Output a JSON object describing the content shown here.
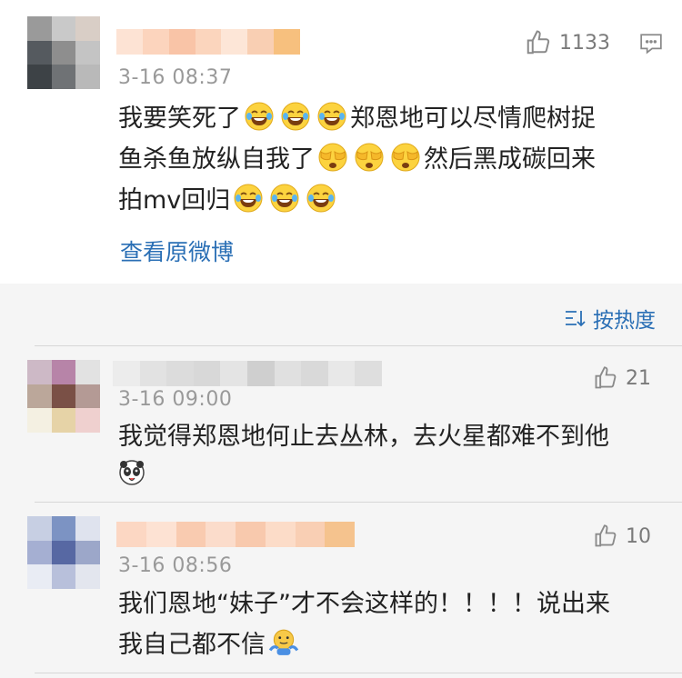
{
  "main_comment": {
    "time": "3-16 08:37",
    "like_count": "1133",
    "text_lines": [
      {
        "before": "我要笑死了",
        "emojis": [
          "laugh",
          "laugh",
          "laugh"
        ],
        "after": "郑恩地可以尽情爬树捉"
      },
      {
        "before": "鱼杀鱼放纵自我了",
        "emojis": [
          "facepalm",
          "facepalm",
          "facepalm"
        ],
        "after": "然后黑成碳回来"
      },
      {
        "before": "拍mv回归",
        "emojis": [
          "laugh",
          "laugh",
          "laugh"
        ],
        "after": ""
      }
    ],
    "view_original": "查看原微博"
  },
  "sort": {
    "label": "按热度"
  },
  "replies": [
    {
      "time": "3-16 09:00",
      "like_count": "21",
      "line1": "我觉得郑恩地何止去丛林，去火星都难不到他",
      "emoji": "panda"
    },
    {
      "time": "3-16 08:56",
      "like_count": "10",
      "line1": "我们恩地“妹子”才不会这样的！！！！说出来",
      "line2": "我自己都不信",
      "emoji": "shrug"
    }
  ],
  "colors": {
    "link_blue": "#2a6fb5",
    "meta_gray": "#999999",
    "background": "#f5f5f5"
  }
}
